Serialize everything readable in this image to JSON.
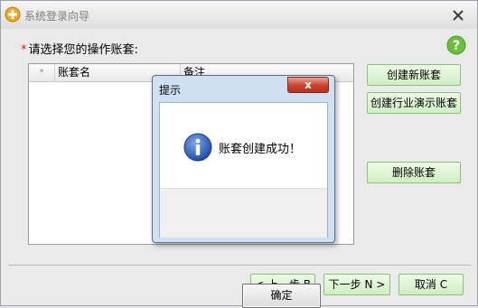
{
  "window": {
    "title": "系统登录向导"
  },
  "main": {
    "prompt": "请选择您的操作账套:",
    "required_mark": "*",
    "table": {
      "columns": [
        "*",
        "账套名",
        "备注"
      ],
      "rows": []
    },
    "buttons": {
      "create_new": "创建新账套",
      "create_demo": "创建行业演示账套",
      "delete": "删除账套"
    }
  },
  "nav": {
    "prev": "< 上一步 B",
    "next": "下一步 N >",
    "cancel": "取消 C"
  },
  "dialog": {
    "title": "提示",
    "message": "账套创建成功！",
    "ok": "确定",
    "close": "x"
  },
  "colors": {
    "accent_green": "#cfeec2",
    "help_green": "#6bbf3a",
    "info_blue": "#2d5fb8",
    "close_red": "#c7412c"
  }
}
